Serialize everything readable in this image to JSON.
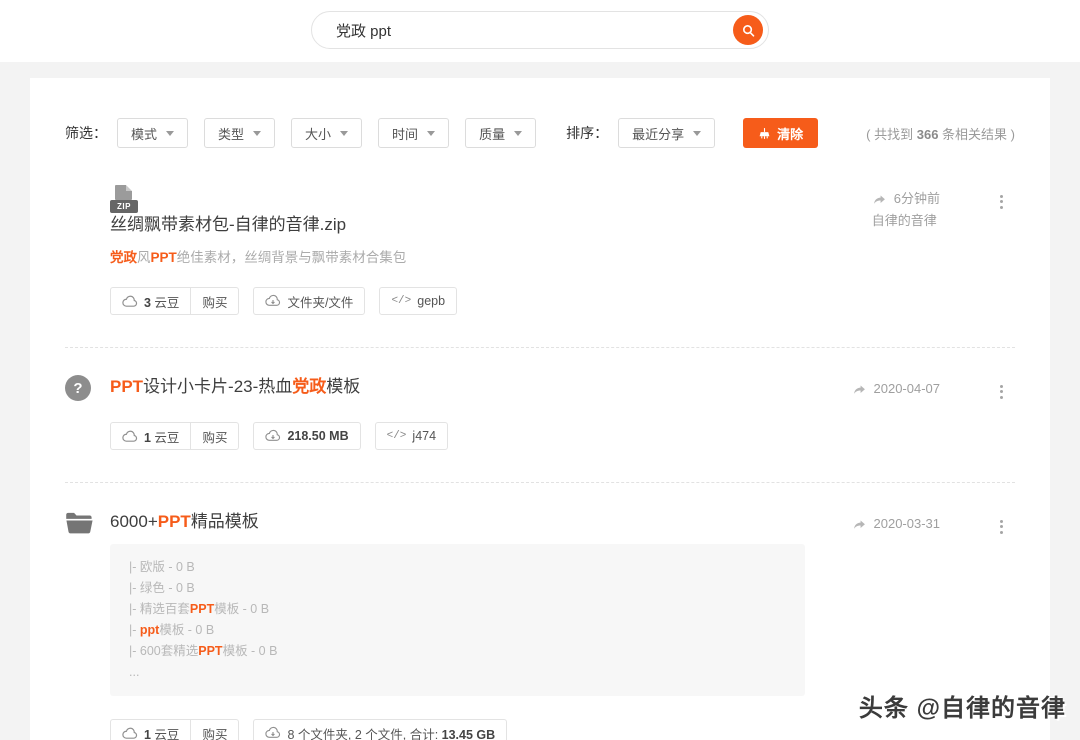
{
  "colors": {
    "accent": "#f65c1a"
  },
  "search": {
    "value": "党政 ppt",
    "icon": "magnifier-icon"
  },
  "filter_bar": {
    "label": "筛选：",
    "dropdowns": [
      {
        "label": "模式"
      },
      {
        "label": "类型"
      },
      {
        "label": "大小"
      },
      {
        "label": "时间"
      },
      {
        "label": "质量"
      }
    ],
    "sort_label": "排序：",
    "sort_dropdown": "最近分享",
    "clear_button": "清除",
    "count_parts": [
      {
        "t": "( 共找到 "
      },
      {
        "t": "366",
        "c": "b"
      },
      {
        "t": " 条相关结果 )"
      }
    ]
  },
  "icons": {
    "code_glyph": "</>",
    "question_glyph": "?"
  },
  "results": [
    {
      "icon": "zip-file-icon",
      "icon_badge": "ZIP",
      "title_parts": [
        {
          "t": "丝绸飘带素材包-自律的音律.zip"
        }
      ],
      "desc_parts": [
        {
          "t": "党政",
          "c": "hl"
        },
        {
          "t": "风"
        },
        {
          "t": "PPT",
          "c": "hl"
        },
        {
          "t": "绝佳素材，丝绸背景与飘带素材合集包"
        }
      ],
      "price_parts": [
        {
          "t": "3",
          "c": "b"
        },
        {
          "t": " 云豆"
        }
      ],
      "buy_label": "购买",
      "info_parts": [
        {
          "t": "文件夹/文件"
        }
      ],
      "code": "gepb",
      "time": "6分钟前",
      "author": "自律的音律"
    },
    {
      "icon": "question-icon",
      "title_parts": [
        {
          "t": "PPT",
          "c": "hl"
        },
        {
          "t": "设计小卡片-23-热血"
        },
        {
          "t": "党政",
          "c": "hl"
        },
        {
          "t": "模板"
        }
      ],
      "price_parts": [
        {
          "t": "1",
          "c": "b"
        },
        {
          "t": " 云豆"
        }
      ],
      "buy_label": "购买",
      "info_parts": [
        {
          "t": "218.50 MB",
          "c": "b"
        }
      ],
      "code": "j474",
      "time": "2020-04-07"
    },
    {
      "icon": "folder-icon",
      "title_parts": [
        {
          "t": "6000+"
        },
        {
          "t": "PPT",
          "c": "hl"
        },
        {
          "t": "精品模板"
        }
      ],
      "files": [
        [
          {
            "t": "|- 欧版 - 0 B"
          }
        ],
        [
          {
            "t": "|- 绿色 - 0 B"
          }
        ],
        [
          {
            "t": "|- 精选百套"
          },
          {
            "t": "PPT",
            "c": "hl"
          },
          {
            "t": "模板 - 0 B"
          }
        ],
        [
          {
            "t": "|- "
          },
          {
            "t": "ppt",
            "c": "hl"
          },
          {
            "t": "模板 - 0 B"
          }
        ],
        [
          {
            "t": "|- 600套精选"
          },
          {
            "t": "PPT",
            "c": "hl"
          },
          {
            "t": "模板 - 0 B"
          }
        ],
        [
          {
            "t": "..."
          }
        ]
      ],
      "price_parts": [
        {
          "t": "1",
          "c": "b"
        },
        {
          "t": " 云豆"
        }
      ],
      "buy_label": "购买",
      "info_parts": [
        {
          "t": "8 个文件夹, 2 个文件, 合计: "
        },
        {
          "t": "13.45 GB",
          "c": "b"
        }
      ],
      "time": "2020-03-31"
    }
  ],
  "watermark": "头条 @自律的音律"
}
